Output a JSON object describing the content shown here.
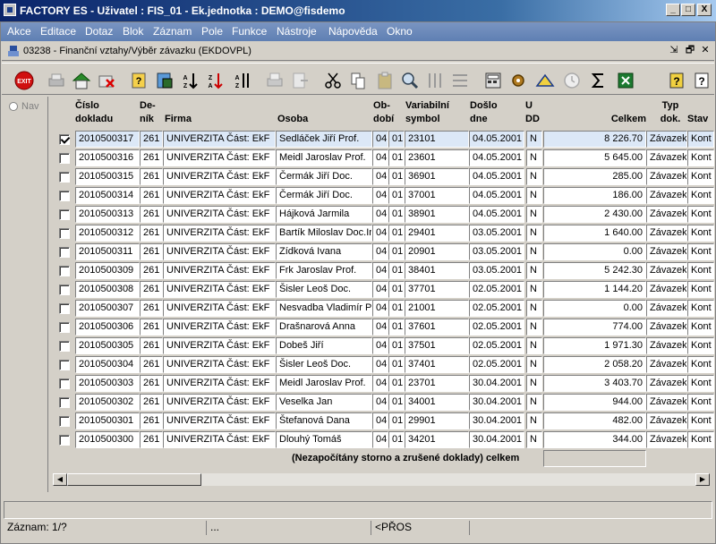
{
  "window": {
    "title": "FACTORY ES - Uživatel : FIS_01 - Ek.jednotka : DEMO@fisdemo",
    "min": "_",
    "max": "□",
    "close": "X"
  },
  "menu": [
    "Akce",
    "Editace",
    "Dotaz",
    "Blok",
    "Záznam",
    "Pole",
    "Funkce",
    "Nástroje",
    "Nápověda",
    "Okno"
  ],
  "form": {
    "title": "03238 - Finanční vztahy/Výběr závazku (EKDOVPL)",
    "controls": [
      "⇲",
      "🗗",
      "✕"
    ]
  },
  "toolbar": {
    "icons": [
      "exit-icon",
      "print-preview-icon",
      "save-icon",
      "delete-icon",
      "query-icon",
      "execute-query-icon",
      "sort-asc-icon",
      "sort-desc-icon",
      "multi-sort-icon",
      "print-icon",
      "export-icon",
      "cut-icon",
      "copy-icon",
      "paste-icon",
      "find-icon",
      "columns-icon",
      "rows-icon",
      "calculator-icon",
      "settings-icon",
      "filter-icon",
      "clock-icon",
      "sum-icon",
      "excel-icon",
      "help-icon",
      "context-help-icon"
    ],
    "exit_label": "EXIT"
  },
  "nav": {
    "label": "Nav"
  },
  "headers": {
    "cislo": [
      "Číslo",
      "dokladu"
    ],
    "denik": [
      "De-",
      "ník"
    ],
    "firma": "Firma",
    "osoba": "Osoba",
    "obdobi": [
      "Ob-",
      "dobí"
    ],
    "variabilni": [
      "Variabilní",
      "symbol"
    ],
    "doslo": [
      "Došlo",
      "dne"
    ],
    "udd": [
      "U",
      "DD"
    ],
    "celkem": "Celkem",
    "typ": [
      "Typ",
      "dok."
    ],
    "stav": "Stav"
  },
  "rows": [
    {
      "checked": true,
      "cislo": "2010500317",
      "denik": "261",
      "firma": "UNIVERZITA Část: EkF",
      "osoba": "Sedláček Jiří Prof.",
      "ob1": "04",
      "ob2": "01",
      "vs": "23101",
      "doslo": "04.05.2001",
      "u": "N",
      "celkem": "8 226.70",
      "typ": "Závazek",
      "stav": "Kont"
    },
    {
      "checked": false,
      "cislo": "2010500316",
      "denik": "261",
      "firma": "UNIVERZITA Část: EkF",
      "osoba": "Meidl Jaroslav Prof.",
      "ob1": "04",
      "ob2": "01",
      "vs": "23601",
      "doslo": "04.05.2001",
      "u": "N",
      "celkem": "5 645.00",
      "typ": "Závazek",
      "stav": "Kont"
    },
    {
      "checked": false,
      "cislo": "2010500315",
      "denik": "261",
      "firma": "UNIVERZITA Část: EkF",
      "osoba": "Čermák Jiří Doc.",
      "ob1": "04",
      "ob2": "01",
      "vs": "36901",
      "doslo": "04.05.2001",
      "u": "N",
      "celkem": "285.00",
      "typ": "Závazek",
      "stav": "Kont"
    },
    {
      "checked": false,
      "cislo": "2010500314",
      "denik": "261",
      "firma": "UNIVERZITA Část: EkF",
      "osoba": "Čermák Jiří Doc.",
      "ob1": "04",
      "ob2": "01",
      "vs": "37001",
      "doslo": "04.05.2001",
      "u": "N",
      "celkem": "186.00",
      "typ": "Závazek",
      "stav": "Kont"
    },
    {
      "checked": false,
      "cislo": "2010500313",
      "denik": "261",
      "firma": "UNIVERZITA Část: EkF",
      "osoba": "Hájková Jarmila",
      "ob1": "04",
      "ob2": "01",
      "vs": "38901",
      "doslo": "04.05.2001",
      "u": "N",
      "celkem": "2 430.00",
      "typ": "Závazek",
      "stav": "Kont"
    },
    {
      "checked": false,
      "cislo": "2010500312",
      "denik": "261",
      "firma": "UNIVERZITA Část: EkF",
      "osoba": "Bartík Miloslav Doc.Ing",
      "ob1": "04",
      "ob2": "01",
      "vs": "29401",
      "doslo": "03.05.2001",
      "u": "N",
      "celkem": "1 640.00",
      "typ": "Závazek",
      "stav": "Kont"
    },
    {
      "checked": false,
      "cislo": "2010500311",
      "denik": "261",
      "firma": "UNIVERZITA Část: EkF",
      "osoba": "Zídková Ivana",
      "ob1": "04",
      "ob2": "01",
      "vs": "20901",
      "doslo": "03.05.2001",
      "u": "N",
      "celkem": "0.00",
      "typ": "Závazek",
      "stav": "Kont"
    },
    {
      "checked": false,
      "cislo": "2010500309",
      "denik": "261",
      "firma": "UNIVERZITA Část: EkF",
      "osoba": "Frk Jaroslav Prof.",
      "ob1": "04",
      "ob2": "01",
      "vs": "38401",
      "doslo": "03.05.2001",
      "u": "N",
      "celkem": "5 242.30",
      "typ": "Závazek",
      "stav": "Kont"
    },
    {
      "checked": false,
      "cislo": "2010500308",
      "denik": "261",
      "firma": "UNIVERZITA Část: EkF",
      "osoba": "Šisler Leoš Doc.",
      "ob1": "04",
      "ob2": "01",
      "vs": "37701",
      "doslo": "02.05.2001",
      "u": "N",
      "celkem": "1 144.20",
      "typ": "Závazek",
      "stav": "Kont"
    },
    {
      "checked": false,
      "cislo": "2010500307",
      "denik": "261",
      "firma": "UNIVERZITA Část: EkF",
      "osoba": "Nesvadba Vladimír Pr",
      "ob1": "04",
      "ob2": "01",
      "vs": "21001",
      "doslo": "02.05.2001",
      "u": "N",
      "celkem": "0.00",
      "typ": "Závazek",
      "stav": "Kont"
    },
    {
      "checked": false,
      "cislo": "2010500306",
      "denik": "261",
      "firma": "UNIVERZITA Část: EkF",
      "osoba": "Drašnarová Anna",
      "ob1": "04",
      "ob2": "01",
      "vs": "37601",
      "doslo": "02.05.2001",
      "u": "N",
      "celkem": "774.00",
      "typ": "Závazek",
      "stav": "Kont"
    },
    {
      "checked": false,
      "cislo": "2010500305",
      "denik": "261",
      "firma": "UNIVERZITA Část: EkF",
      "osoba": "Dobeš Jiří",
      "ob1": "04",
      "ob2": "01",
      "vs": "37501",
      "doslo": "02.05.2001",
      "u": "N",
      "celkem": "1 971.30",
      "typ": "Závazek",
      "stav": "Kont"
    },
    {
      "checked": false,
      "cislo": "2010500304",
      "denik": "261",
      "firma": "UNIVERZITA Část: EkF",
      "osoba": "Šisler Leoš Doc.",
      "ob1": "04",
      "ob2": "01",
      "vs": "37401",
      "doslo": "02.05.2001",
      "u": "N",
      "celkem": "2 058.20",
      "typ": "Závazek",
      "stav": "Kont"
    },
    {
      "checked": false,
      "cislo": "2010500303",
      "denik": "261",
      "firma": "UNIVERZITA Část: EkF",
      "osoba": "Meidl Jaroslav Prof.",
      "ob1": "04",
      "ob2": "01",
      "vs": "23701",
      "doslo": "30.04.2001",
      "u": "N",
      "celkem": "3 403.70",
      "typ": "Závazek",
      "stav": "Kont"
    },
    {
      "checked": false,
      "cislo": "2010500302",
      "denik": "261",
      "firma": "UNIVERZITA Část: EkF",
      "osoba": "Veselka Jan",
      "ob1": "04",
      "ob2": "01",
      "vs": "34001",
      "doslo": "30.04.2001",
      "u": "N",
      "celkem": "944.00",
      "typ": "Závazek",
      "stav": "Kont"
    },
    {
      "checked": false,
      "cislo": "2010500301",
      "denik": "261",
      "firma": "UNIVERZITA Část: EkF",
      "osoba": "Štefanová Dana",
      "ob1": "04",
      "ob2": "01",
      "vs": "29901",
      "doslo": "30.04.2001",
      "u": "N",
      "celkem": "482.00",
      "typ": "Závazek",
      "stav": "Kont"
    },
    {
      "checked": false,
      "cislo": "2010500300",
      "denik": "261",
      "firma": "UNIVERZITA Část: EkF",
      "osoba": "Dlouhý Tomáš",
      "ob1": "04",
      "ob2": "01",
      "vs": "34201",
      "doslo": "30.04.2001",
      "u": "N",
      "celkem": "344.00",
      "typ": "Závazek",
      "stav": "Kont"
    }
  ],
  "summary": {
    "label": "(Nezapočítány storno a zrušené doklady) celkem",
    "value": ""
  },
  "status": {
    "record": "Záznam: 1/?",
    "ellipsis": "...",
    "mode": "<PŘOS"
  },
  "colors": {
    "menu_bg": "#6a87b8",
    "title_bg": "#0a246a",
    "selected_row": "#dce8f7",
    "face": "#d4d0c8"
  }
}
